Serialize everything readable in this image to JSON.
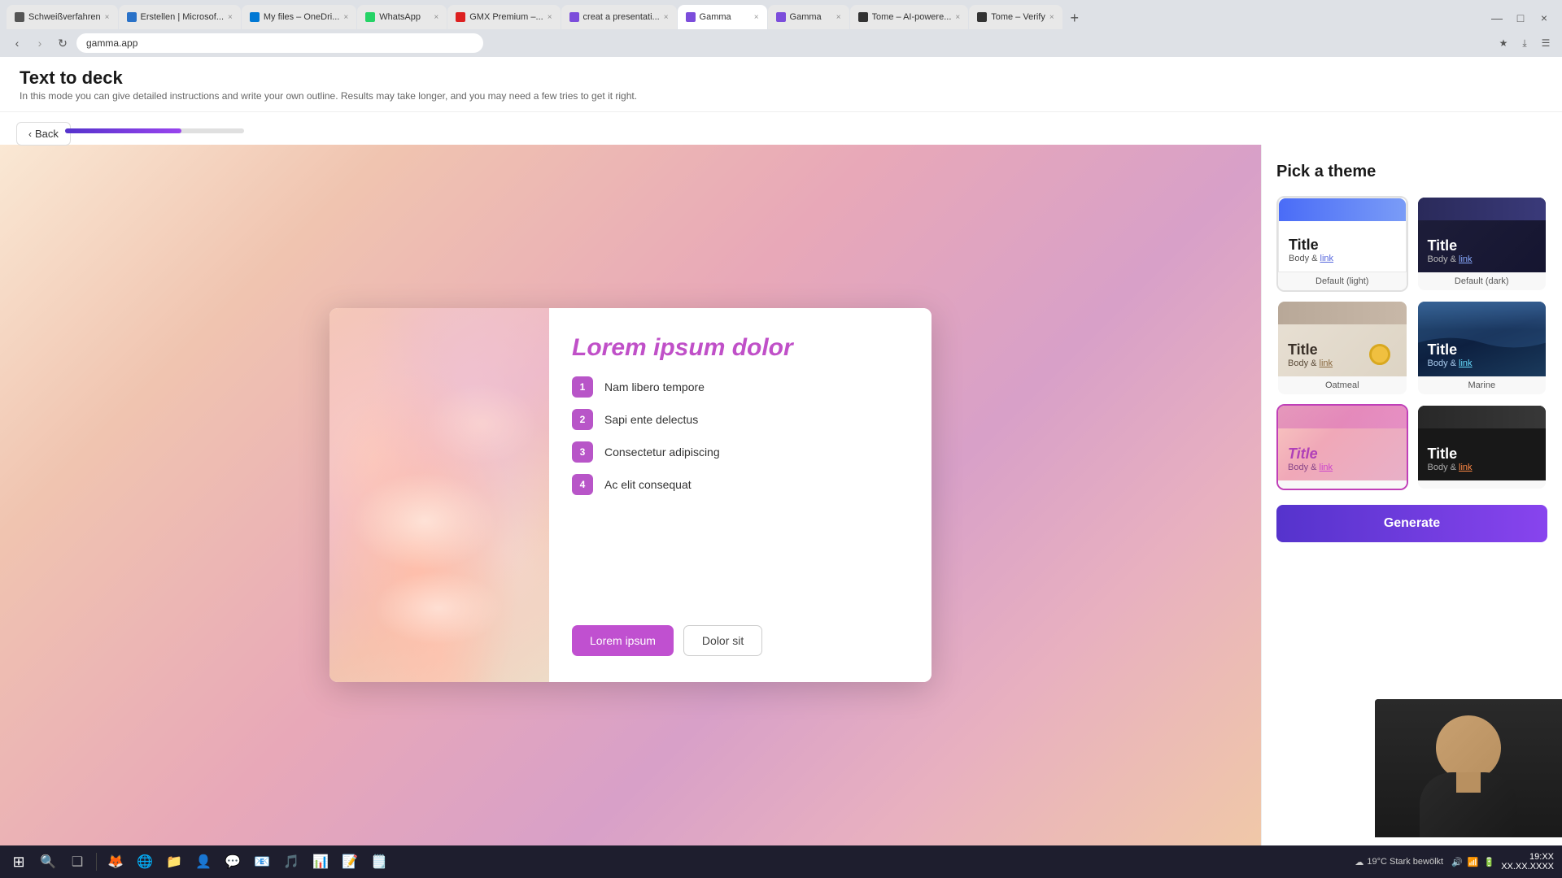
{
  "browser": {
    "tabs": [
      {
        "label": "Schweißverfahren",
        "favicon_color": "#4a90d9",
        "active": false
      },
      {
        "label": "Erstellen | Microsof...",
        "favicon_color": "#2a72c8",
        "active": false
      },
      {
        "label": "My files – OneDri...",
        "favicon_color": "#0078d4",
        "active": false
      },
      {
        "label": "WhatsApp",
        "favicon_color": "#25d366",
        "active": false
      },
      {
        "label": "GMX Premium –...",
        "favicon_color": "#dd2020",
        "active": false
      },
      {
        "label": "creat a presentati...",
        "favicon_color": "#7c4ddb",
        "active": false
      },
      {
        "label": "Gamma",
        "favicon_color": "#7c4ddb",
        "active": true
      },
      {
        "label": "Gamma",
        "favicon_color": "#7c4ddb",
        "active": false
      },
      {
        "label": "Tome – AI-powere...",
        "favicon_color": "#333",
        "active": false
      },
      {
        "label": "Tome – Verify",
        "favicon_color": "#333",
        "active": false
      }
    ],
    "address": "gamma.app"
  },
  "app": {
    "title": "Text to deck",
    "subtitle": "In this mode you can give detailed instructions and write your own outline. Results may take longer, and you may need a few tries to get it right.",
    "back_label": "Back"
  },
  "slide": {
    "heading": "Lorem ipsum dolor",
    "items": [
      {
        "num": "1",
        "text": "Nam libero tempore"
      },
      {
        "num": "2",
        "text": "Sapi ente delectus"
      },
      {
        "num": "3",
        "text": "Consectetur adipiscing"
      },
      {
        "num": "4",
        "text": "Ac elit consequat"
      }
    ],
    "btn_primary": "Lorem ipsum",
    "btn_secondary": "Dolor sit"
  },
  "theme_panel": {
    "title": "Pick a theme",
    "themes": [
      {
        "id": "default-light",
        "label": "Default (light)",
        "title_text": "Title",
        "body_text": "Body & ",
        "link_text": "link"
      },
      {
        "id": "default-dark",
        "label": "Default (dark)",
        "title_text": "Title",
        "body_text": "Body & ",
        "link_text": "link"
      },
      {
        "id": "oatmeal",
        "label": "Oatmeal",
        "title_text": "Title",
        "body_text": "Body & ",
        "link_text": "link"
      },
      {
        "id": "marine",
        "label": "Marine",
        "title_text": "Title",
        "body_text": "Body & ",
        "link_text": "link"
      },
      {
        "id": "warm",
        "label": "",
        "title_text": "Title",
        "body_text": "Body & ",
        "link_text": "link"
      },
      {
        "id": "dark2",
        "label": "",
        "title_text": "Title",
        "body_text": "Body & ",
        "link_text": "link"
      }
    ],
    "generate_label": "Generate"
  },
  "taskbar": {
    "time": "19:°C Stark bewölkt",
    "weather": "19°C  Stark bewölkt"
  }
}
